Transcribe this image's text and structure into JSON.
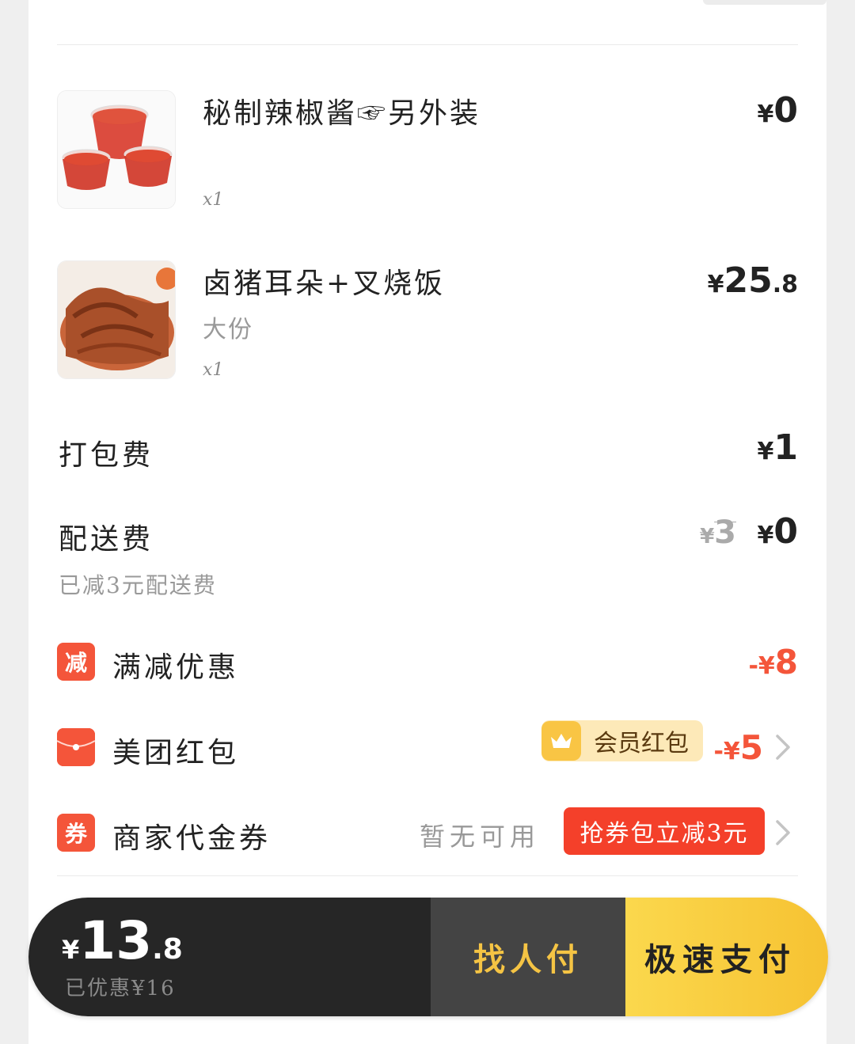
{
  "items": [
    {
      "name": "秘制辣椒酱☞另外装",
      "spec": "",
      "qty": "x1",
      "price": {
        "yen": "¥",
        "int": "0",
        "dec": ""
      },
      "thumb": "chili-sauce-image"
    },
    {
      "name": "卤猪耳朵+叉烧饭",
      "spec": "大份",
      "qty": "x1",
      "price": {
        "yen": "¥",
        "int": "25",
        "dec": ".8"
      },
      "thumb": "pig-ear-image"
    }
  ],
  "packing": {
    "label": "打包费",
    "price": {
      "yen": "¥",
      "int": "1"
    }
  },
  "delivery": {
    "label": "配送费",
    "sub": "已减3元配送费",
    "original": {
      "yen": "¥",
      "int": "3"
    },
    "price": {
      "yen": "¥",
      "int": "0"
    }
  },
  "discounts": {
    "full_reduction": {
      "badge": "减",
      "label": "满减优惠",
      "amount": {
        "prefix": "-¥",
        "int": "8"
      }
    },
    "red_packet": {
      "label": "美团红包",
      "member_tag": "会员红包",
      "amount": {
        "prefix": "-¥",
        "int": "5"
      }
    },
    "coupon": {
      "badge": "券",
      "label": "商家代金券",
      "status": "暂无可用",
      "action": "抢券包立减3元"
    }
  },
  "paybar": {
    "total": {
      "yen": "¥",
      "int": "13",
      "dec": ".8"
    },
    "saved": "已优惠¥16",
    "friend_pay": "找人付",
    "fast_pay": "极速支付"
  },
  "colors": {
    "accent_red": "#f4553a",
    "yellow": "#f6c232",
    "dark": "#262626"
  }
}
